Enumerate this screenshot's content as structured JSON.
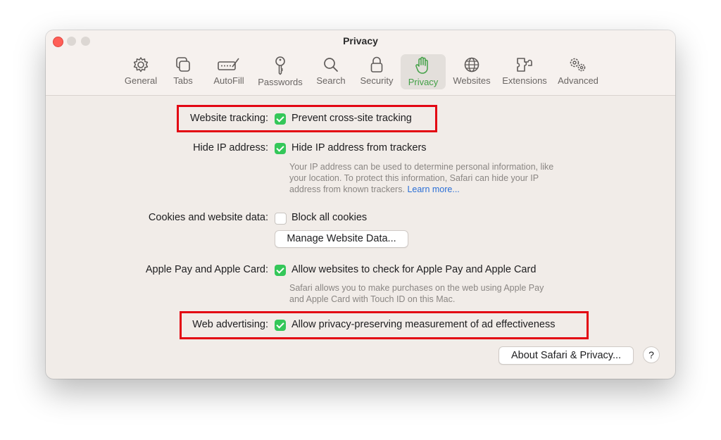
{
  "window": {
    "title": "Privacy"
  },
  "toolbar": {
    "items": [
      {
        "label": "General",
        "icon": "gear-icon"
      },
      {
        "label": "Tabs",
        "icon": "tabs-icon"
      },
      {
        "label": "AutoFill",
        "icon": "autofill-icon"
      },
      {
        "label": "Passwords",
        "icon": "key-icon"
      },
      {
        "label": "Search",
        "icon": "search-icon"
      },
      {
        "label": "Security",
        "icon": "lock-icon"
      },
      {
        "label": "Privacy",
        "icon": "hand-icon"
      },
      {
        "label": "Websites",
        "icon": "globe-icon"
      },
      {
        "label": "Extensions",
        "icon": "puzzle-icon"
      },
      {
        "label": "Advanced",
        "icon": "gears-icon"
      }
    ],
    "active": "Privacy",
    "active_color": "#43a047"
  },
  "settings": {
    "website_tracking": {
      "label": "Website tracking:",
      "option": "Prevent cross-site tracking",
      "checked": true
    },
    "hide_ip": {
      "label": "Hide IP address:",
      "option": "Hide IP address from trackers",
      "checked": true,
      "desc_line1": "Your IP address can be used to determine personal information, like",
      "desc_line2": "your location. To protect this information, Safari can hide your IP",
      "desc_line3": "address from known trackers.",
      "learn_more": "Learn more..."
    },
    "cookies": {
      "label": "Cookies and website data:",
      "option": "Block all cookies",
      "checked": false,
      "manage_button": "Manage Website Data..."
    },
    "apple_pay": {
      "label": "Apple Pay and Apple Card:",
      "option": "Allow websites to check for Apple Pay and Apple Card",
      "checked": true,
      "desc_line1": "Safari allows you to make purchases on the web using Apple Pay",
      "desc_line2": "and Apple Card with Touch ID on this Mac."
    },
    "web_advertising": {
      "label": "Web advertising:",
      "option": "Allow privacy-preserving measurement of ad effectiveness",
      "checked": true
    }
  },
  "footer": {
    "about_button": "About Safari & Privacy...",
    "help": "?"
  },
  "colors": {
    "checkbox_on": "#34c759",
    "highlight": "#e30613",
    "link": "#2b6fd6"
  }
}
